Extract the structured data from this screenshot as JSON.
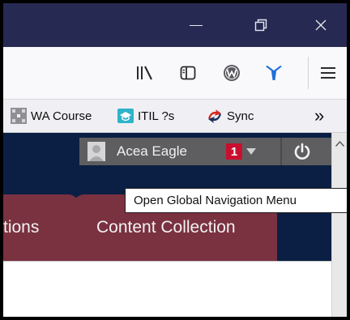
{
  "window": {
    "min_icon": "minimize-icon",
    "restore_icon": "restore-icon",
    "close_icon": "close-icon"
  },
  "toolbar": {
    "icons": [
      "library-icon",
      "sidebar-icon",
      "w-extension-icon",
      "vpn-icon",
      "menu-icon"
    ]
  },
  "bookmarks": [
    {
      "label": "WA Course",
      "icon": "wa-course-icon"
    },
    {
      "label": "ITIL ?s",
      "icon": "itil-icon"
    },
    {
      "label": "Sync",
      "icon": "sync-icon"
    }
  ],
  "bookmarks_overflow": "»",
  "userbar": {
    "user_name": "Acea Eagle",
    "notification_count": "1",
    "power_icon": "power-icon"
  },
  "tabs": [
    {
      "label": "tions"
    },
    {
      "label": "Content Collection"
    }
  ],
  "tooltip": {
    "text": "Open Global Navigation Menu"
  },
  "colors": {
    "titlebar": "#262a52",
    "content_bg": "#0a1f43",
    "tab_bg": "#7a3140",
    "badge": "#c8102e"
  }
}
